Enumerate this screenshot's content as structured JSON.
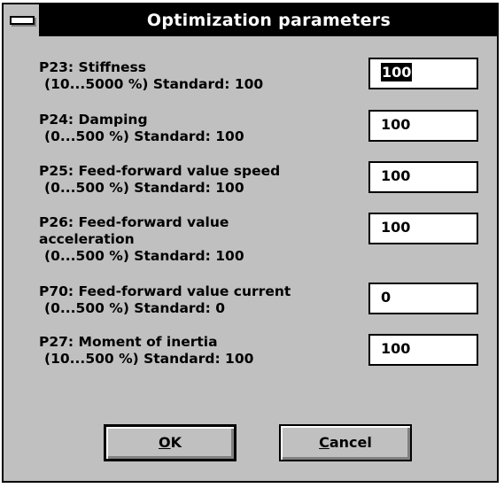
{
  "window": {
    "title": "Optimization parameters"
  },
  "params": [
    {
      "label_lines": [
        "P23: Stiffness"
      ],
      "range": "(10...5000 %)  Standard: 100",
      "value": "100",
      "selected": true
    },
    {
      "label_lines": [
        "P24: Damping"
      ],
      "range": "(0...500 %)  Standard: 100",
      "value": "100",
      "selected": false
    },
    {
      "label_lines": [
        "P25: Feed-forward value speed"
      ],
      "range": "(0...500 %)  Standard: 100",
      "value": "100",
      "selected": false
    },
    {
      "label_lines": [
        "P26: Feed-forward value",
        "acceleration"
      ],
      "range": "(0...500 %)  Standard: 100",
      "value": "100",
      "selected": false
    },
    {
      "label_lines": [
        "P70: Feed-forward value current"
      ],
      "range": "(0...500 %)  Standard: 0",
      "value": "0",
      "selected": false
    },
    {
      "label_lines": [
        "P27: Moment of inertia"
      ],
      "range": "(10...500 %)  Standard: 100",
      "value": "100",
      "selected": false
    }
  ],
  "buttons": {
    "ok_mnemonic": "O",
    "ok_rest": "K",
    "cancel_mnemonic": "C",
    "cancel_rest": "ancel"
  },
  "colors": {
    "dialog_face": "#c0c0c0",
    "titlebar": "#000000",
    "title_text": "#ffffff",
    "field_bg": "#ffffff",
    "selection": "#000000"
  }
}
